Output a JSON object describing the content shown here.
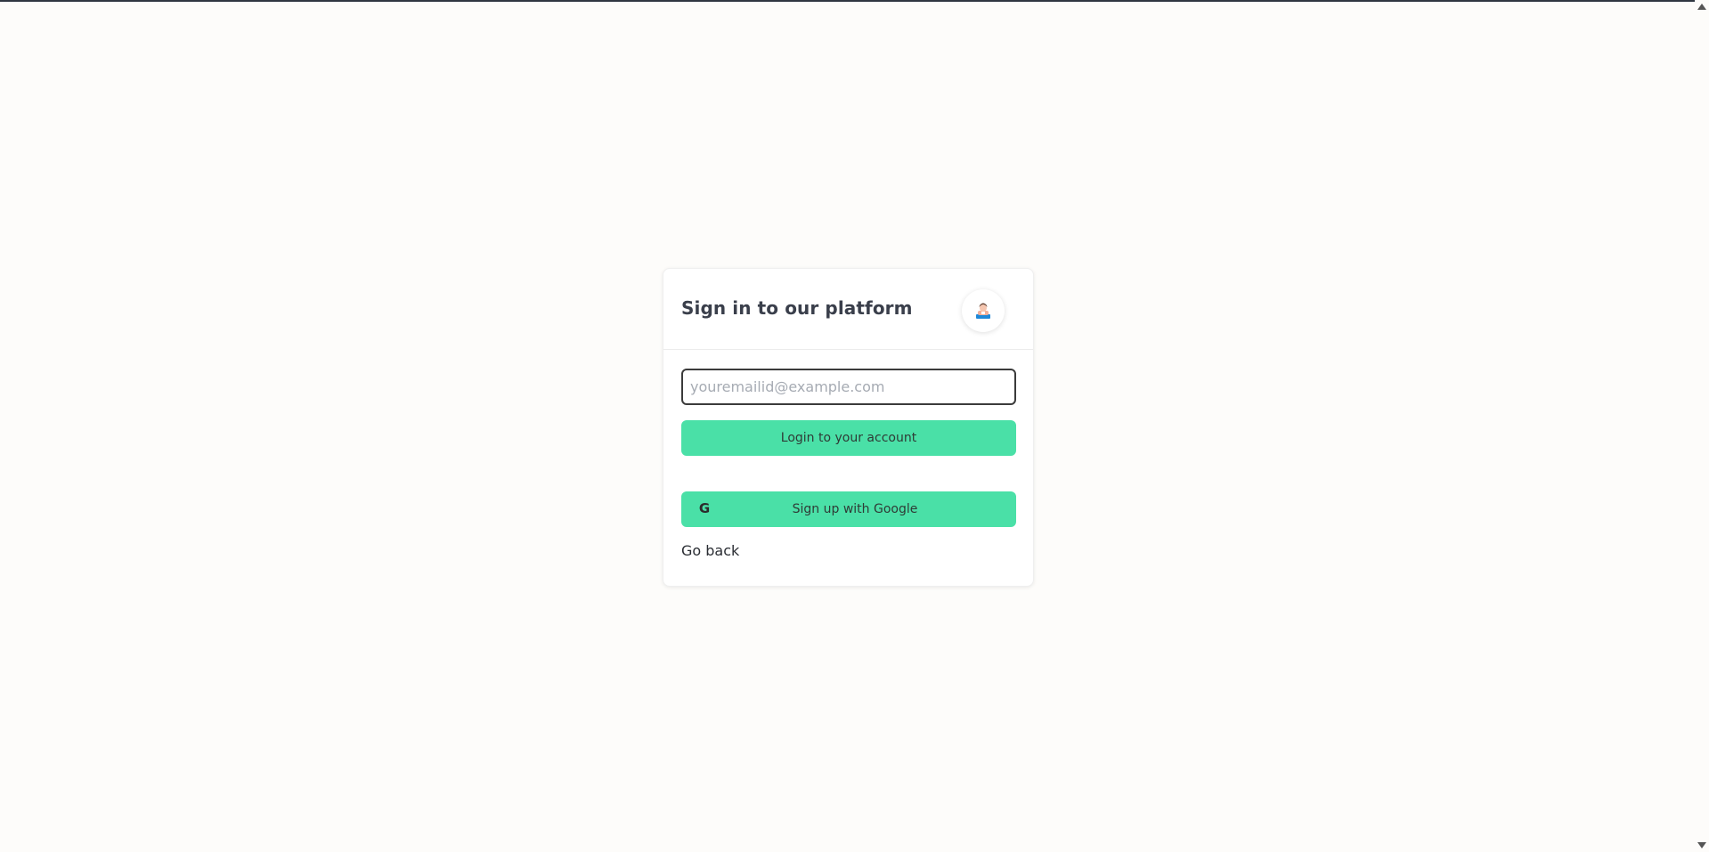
{
  "card": {
    "title": "Sign in to our platform"
  },
  "form": {
    "email_placeholder": "youremailid@example.com",
    "email_value": "",
    "login_label": "Login to your account",
    "google_label": "Sign up with Google",
    "google_icon_glyph": "G",
    "go_back_label": "Go back"
  },
  "icons": {
    "avatar": "user-avatar-icon",
    "google": "google-icon"
  },
  "colors": {
    "accent": "#4ae0a7",
    "background": "#fdfcfa",
    "title": "#3a3f4b"
  }
}
